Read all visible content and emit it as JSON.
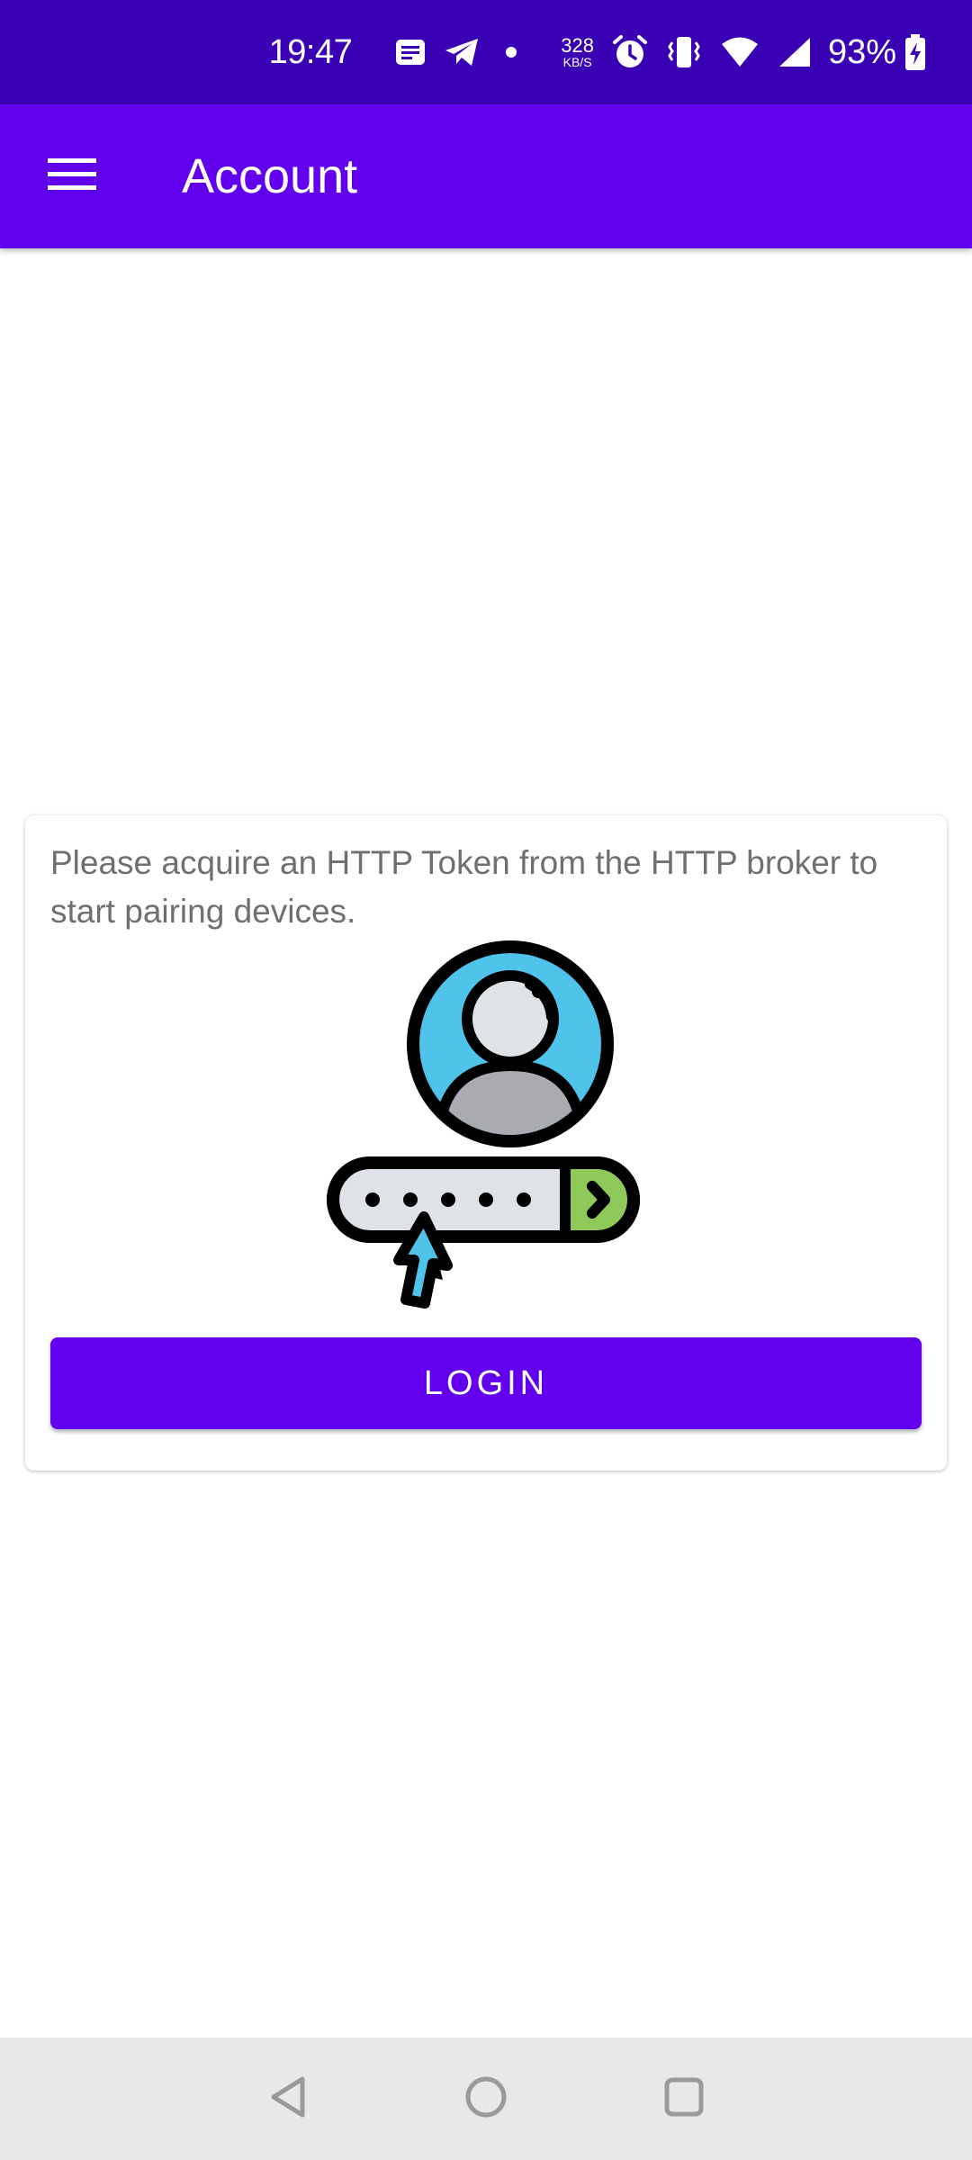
{
  "status_bar": {
    "time": "19:47",
    "net_speed_value": "328",
    "net_speed_unit": "KB/S",
    "battery_percent": "93%",
    "icons": [
      "message-icon",
      "telegram-icon",
      "dot-icon",
      "alarm-icon",
      "vibrate-icon",
      "wifi-icon",
      "cell-signal-icon",
      "battery-charging-icon"
    ]
  },
  "app_bar": {
    "title": "Account",
    "menu_icon": "hamburger-menu-icon",
    "background": "#6200ee"
  },
  "card": {
    "message": "Please acquire an HTTP Token from the HTTP broker to start pairing devices.",
    "illustration": "user-password-login-illustration",
    "login_label": "LOGIN",
    "accent": "#6200ee"
  },
  "nav_bar": {
    "buttons": [
      "back-icon",
      "home-icon",
      "recents-icon"
    ]
  }
}
